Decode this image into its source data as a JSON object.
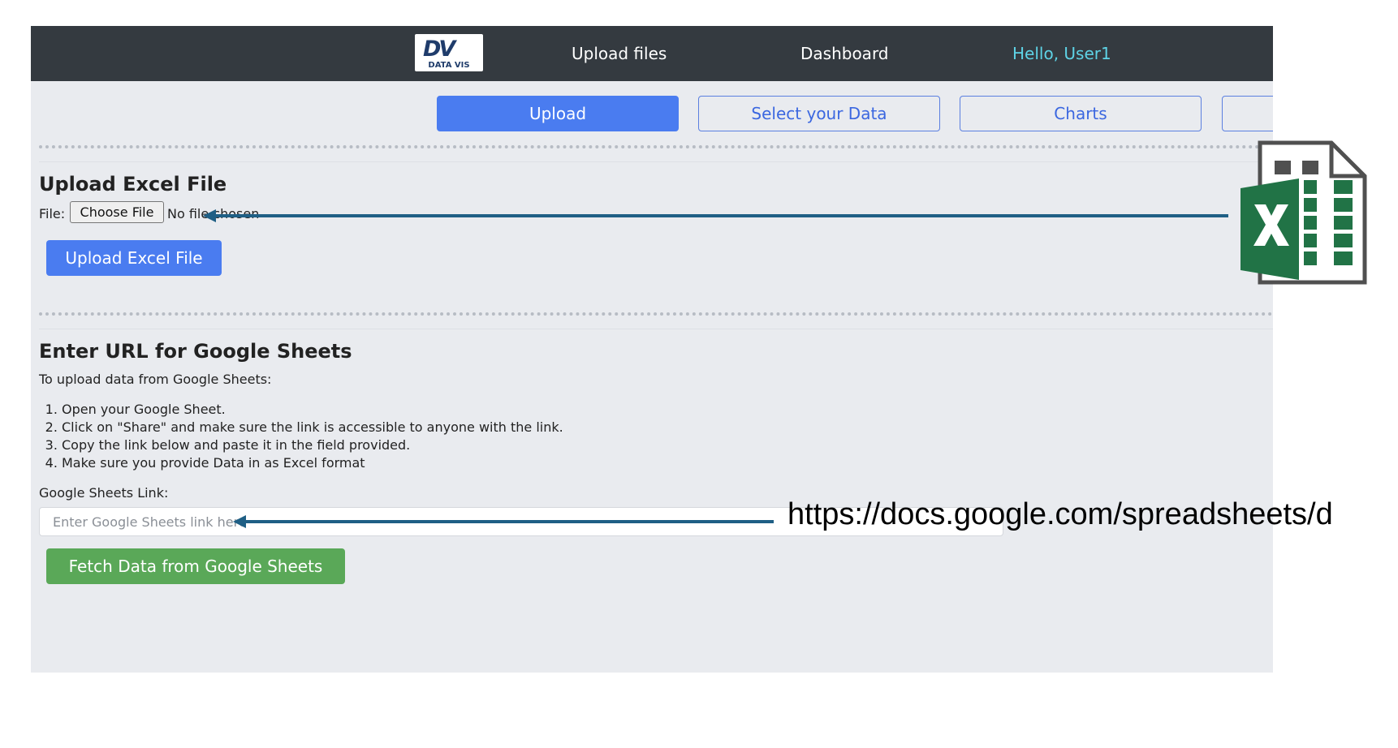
{
  "navbar": {
    "logo_text": "DATA VIS",
    "logo_mark": "DV",
    "links": [
      "Upload files",
      "Dashboard"
    ],
    "user_greeting": "Hello, User1"
  },
  "tabs": [
    {
      "label": "Upload",
      "active": true
    },
    {
      "label": "Select your Data",
      "active": false
    },
    {
      "label": "Charts",
      "active": false
    },
    {
      "label": "",
      "active": false
    }
  ],
  "excel_section": {
    "title": "Upload Excel File",
    "file_label": "File:",
    "choose_button": "Choose File",
    "no_file_text": "No file chosen",
    "upload_button": "Upload Excel File"
  },
  "sheets_section": {
    "title": "Enter URL for Google Sheets",
    "intro": "To upload data from Google Sheets:",
    "steps": [
      "Open your Google Sheet.",
      "Click on \"Share\" and make sure the link is accessible to anyone with the link.",
      "Copy the link below and paste it in the field provided.",
      "Make sure you provide Data in as Excel format"
    ],
    "link_label": "Google Sheets Link:",
    "link_placeholder": "Enter Google Sheets link here",
    "fetch_button": "Fetch Data from Google Sheets"
  },
  "annotations": {
    "url_text": "https://docs.google.com/spreadsheets/d",
    "excel_icon": "excel-icon",
    "arrow_color": "#1f5f85"
  },
  "colors": {
    "navbar_bg": "#343a40",
    "primary": "#4a7cf0",
    "success": "#5aa858",
    "user_accent": "#5ed3e6",
    "excel_green": "#217346"
  }
}
